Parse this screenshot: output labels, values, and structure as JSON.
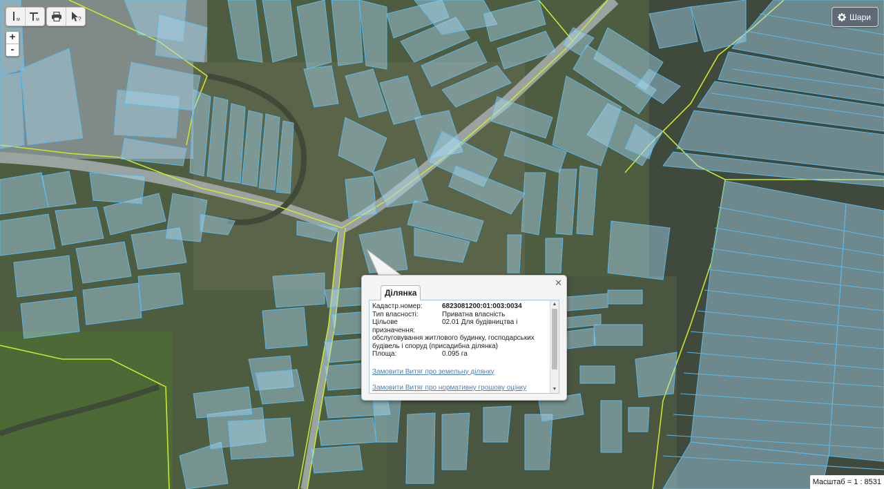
{
  "toolbar": {
    "measure_distance": "distance-measure",
    "measure_area": "area-measure",
    "print": "print",
    "identify": "identify"
  },
  "zoom": {
    "in_label": "+",
    "out_label": "-"
  },
  "layers_button": {
    "label": "Шари",
    "icon": "gear-icon"
  },
  "popup": {
    "tab_label": "Ділянка",
    "cadastral_label": "Кадастр.номер:",
    "cadastral_value": "6823081200:01:003:0034",
    "ownership_label": "Тип власності:",
    "ownership_value": "Приватна власність",
    "purpose_label": "Цільове призначення:",
    "purpose_value_line1": "02.01 Для будівництва і",
    "purpose_value_rest": "обслуговування житлового будинку, господарських будівель і споруд (присадибна ділянка)",
    "area_label": "Площа:",
    "area_value": "0.095 га",
    "link_extract": "Замовити Витяг про земельну ділянку",
    "link_valuation": "Замовити Витяг про нормативну грошову оцінку"
  },
  "scale": {
    "text": "Масштаб = 1 : 8531"
  },
  "colors": {
    "parcel_fill": "#a8d8f0",
    "parcel_stroke": "#5bb8e8",
    "boundary": "#c8e830",
    "road": "#9aa3a0",
    "field_dark": "#3c4632",
    "link": "#4b7fb6"
  }
}
